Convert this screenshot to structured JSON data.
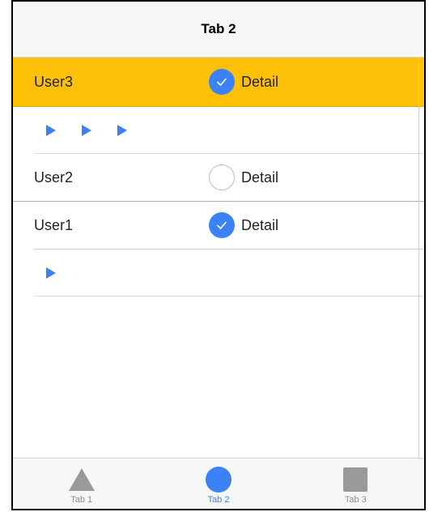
{
  "navbar": {
    "title": "Tab 2"
  },
  "rows": [
    {
      "user": "User3",
      "detail": "Detail",
      "checked": true,
      "selected": true
    },
    {
      "user": "User2",
      "detail": "Detail",
      "checked": false,
      "selected": false
    },
    {
      "user": "User1",
      "detail": "Detail",
      "checked": true,
      "selected": false
    }
  ],
  "tabs": [
    {
      "label": "Tab 1",
      "icon": "triangle-icon",
      "active": false
    },
    {
      "label": "Tab 2",
      "icon": "circle-icon",
      "active": true
    },
    {
      "label": "Tab 3",
      "icon": "square-icon",
      "active": false
    }
  ],
  "colors": {
    "selected_row": "#ffc107",
    "accent": "#3b82f6",
    "inactive_icon": "#999999"
  }
}
